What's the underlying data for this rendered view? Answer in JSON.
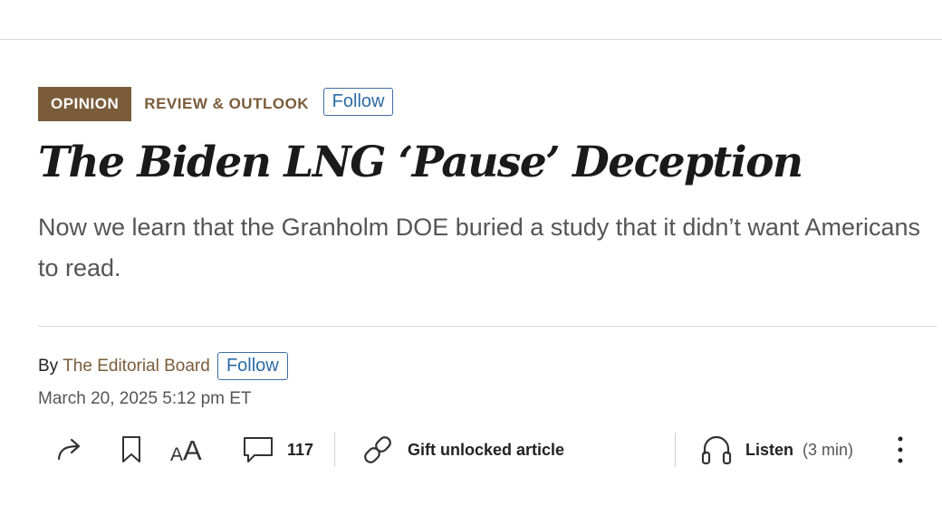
{
  "section": {
    "badge": "OPINION",
    "name": "REVIEW & OUTLOOK",
    "follow_label": "Follow"
  },
  "article": {
    "headline": "The Biden LNG ‘Pause’ Deception",
    "dek": "Now we learn that the Granholm DOE buried a study that it didn’t want Americans to read."
  },
  "byline": {
    "prefix": "By",
    "author": "The Editorial Board",
    "follow_label": "Follow",
    "date": "March 20, 2025 5:12 pm ET"
  },
  "toolbar": {
    "share_icon": "share-icon",
    "bookmark_icon": "bookmark-icon",
    "text_size_icon": "text-size-icon",
    "text_size_glyph": "AA",
    "comment_icon": "comment-icon",
    "comment_count": "117",
    "gift_icon": "link-icon",
    "gift_label": "Gift unlocked article",
    "listen_icon": "headphones-icon",
    "listen_label": "Listen",
    "listen_duration": "(3 min)",
    "more_icon": "more-vertical-icon"
  },
  "colors": {
    "accent_brown": "#7b5c3a",
    "link_blue": "#2c6aa6"
  }
}
